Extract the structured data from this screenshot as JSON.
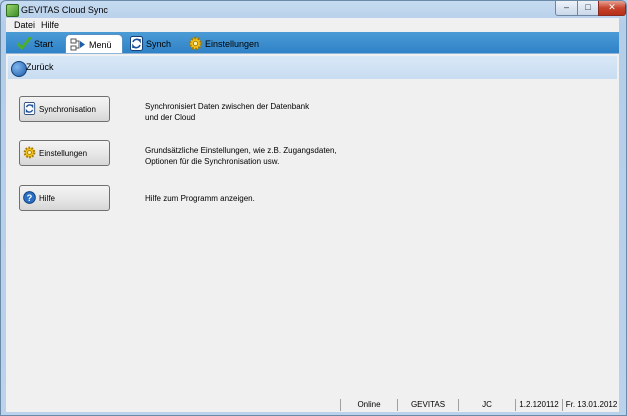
{
  "window": {
    "title": "GEVITAS Cloud Sync"
  },
  "window_controls": {
    "minimize": "–",
    "maximize": "□",
    "close": "✕"
  },
  "menu": {
    "items": [
      {
        "label": "Datei"
      },
      {
        "label": "Hilfe"
      }
    ]
  },
  "tabs": [
    {
      "label": "Start",
      "icon": "checkmark-icon"
    },
    {
      "label": "Menü",
      "icon": "menu-flow-icon",
      "active": true
    },
    {
      "label": "Synch",
      "icon": "sync-icon"
    },
    {
      "label": "Einstellungen",
      "icon": "gear-icon"
    }
  ],
  "back": {
    "label": "Zurück",
    "icon": "back-arrow-icon"
  },
  "actions": [
    {
      "button": "Synchronisation",
      "description": "Synchronisiert Daten zwischen der Datenbank\nund der Cloud",
      "icon": "sync-icon"
    },
    {
      "button": "Einstellungen",
      "description": "Grundsätzliche Einstellungen, wie z.B. Zugangsdaten,\nOptionen für die Synchronisation usw.",
      "icon": "gear-icon"
    },
    {
      "button": "Hilfe",
      "description": "Hilfe zum Programm anzeigen.",
      "icon": "help-icon"
    }
  ],
  "status": {
    "connection": "Online",
    "company": "GEVITAS",
    "user": "JC",
    "version": "1.2.120112",
    "date": "Fr. 13.01.2012"
  },
  "colors": {
    "tab_bar": "#3a8ccf",
    "back_bar": "#d0e2f4",
    "window_frame": "#b9d1ea"
  }
}
